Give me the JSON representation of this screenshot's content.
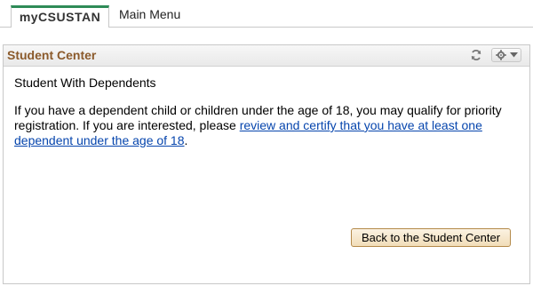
{
  "tabs": [
    {
      "label": "myCSUSTAN",
      "active": true
    },
    {
      "label": "Main Menu",
      "active": false
    }
  ],
  "pagelet": {
    "title": "Student Center",
    "refresh_icon": "refresh-icon",
    "settings_icon": "gear-icon"
  },
  "content": {
    "heading": "Student With Dependents",
    "paragraph_before_link": "If you have a dependent child or children under the age of 18, you may qualify for priority registration. If you are interested, please ",
    "link_text": "review and certify that you have at least one dependent under the age of 18",
    "paragraph_after_link": "."
  },
  "buttons": {
    "back_label": "Back to the Student Center"
  },
  "colors": {
    "tab_active_accent": "#2e8b57",
    "pagelet_title": "#8b5a2b",
    "link": "#0645ad",
    "button_bg": "#f1ddb8",
    "button_border": "#b48a4a"
  }
}
